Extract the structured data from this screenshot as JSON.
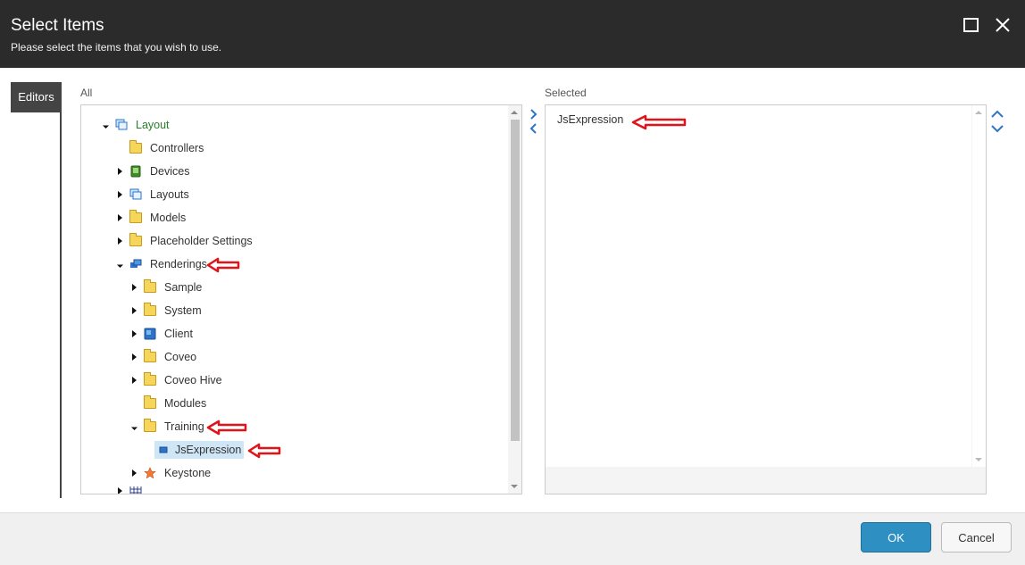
{
  "dialog": {
    "title": "Select Items",
    "subtitle": "Please select the items that you wish to use.",
    "maximize_icon": "maximize-icon",
    "close_icon": "close-icon"
  },
  "tabs": {
    "editors": "Editors"
  },
  "tree": {
    "label": "All",
    "nodes": [
      {
        "label": "Layout",
        "icon": "layout-icon",
        "expanded": true
      },
      {
        "label": "Controllers",
        "icon": "folder-icon"
      },
      {
        "label": "Devices",
        "icon": "device-icon"
      },
      {
        "label": "Layouts",
        "icon": "layout-icon"
      },
      {
        "label": "Models",
        "icon": "folder-icon"
      },
      {
        "label": "Placeholder Settings",
        "icon": "folder-icon"
      },
      {
        "label": "Renderings",
        "icon": "rendering-icon",
        "expanded": true
      },
      {
        "label": "Sample",
        "icon": "folder-icon"
      },
      {
        "label": "System",
        "icon": "folder-icon"
      },
      {
        "label": "Client",
        "icon": "client-icon"
      },
      {
        "label": "Coveo",
        "icon": "folder-icon"
      },
      {
        "label": "Coveo Hive",
        "icon": "folder-icon"
      },
      {
        "label": "Modules",
        "icon": "folder-icon"
      },
      {
        "label": "Training",
        "icon": "folder-icon",
        "expanded": true
      },
      {
        "label": "JsExpression",
        "icon": "rendering-icon",
        "selected": true
      },
      {
        "label": "Keystone",
        "icon": "star-icon"
      }
    ]
  },
  "selected": {
    "label": "Selected",
    "items": [
      "JsExpression"
    ]
  },
  "footer": {
    "ok": "OK",
    "cancel": "Cancel"
  },
  "colors": {
    "header_bg": "#2b2b2b",
    "ok_bg": "#2d8fc2",
    "annotation_red": "#e0131a",
    "tree_root_green": "#2a7d2a"
  }
}
